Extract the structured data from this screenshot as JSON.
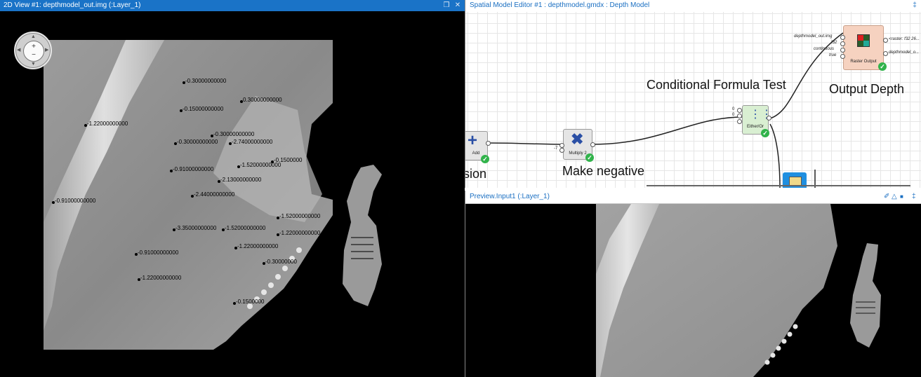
{
  "view2d": {
    "title": "2D View #1: depthmodel_out.img (:Layer_1)",
    "controls": [
      "❒",
      "✕"
    ],
    "nav": {
      "zoom_in": "+",
      "zoom_out": "−"
    },
    "points": [
      {
        "label": "-0.30000000000"
      },
      {
        "label": "0.30000000000"
      },
      {
        "label": "-0.15000000000"
      },
      {
        "label": "-1.22000000000"
      },
      {
        "label": "-0.30000000000"
      },
      {
        "label": "-0.30000000000"
      },
      {
        "label": "-2.74000000000"
      },
      {
        "label": "-0.1500000"
      },
      {
        "label": "-1.52000000000"
      },
      {
        "label": "-0.91000000000"
      },
      {
        "label": "-2.13000000000"
      },
      {
        "label": "-2.44000000000"
      },
      {
        "label": "-0.91000000000"
      },
      {
        "label": "-1.52000000000"
      },
      {
        "label": "-3.35000000000"
      },
      {
        "label": "-1.52000000000"
      },
      {
        "label": "-1.22000000000"
      },
      {
        "label": "-1.22000000000"
      },
      {
        "label": "-0.91000000000"
      },
      {
        "label": "-0.30000000"
      },
      {
        "label": "-1.22000000000"
      },
      {
        "label": "-0.1500000"
      }
    ]
  },
  "editor": {
    "title": "Spatial Model Editor #1 : depthmodel.gmdx : Depth Model",
    "pin": "‡",
    "nodes": {
      "add": {
        "label": "Add"
      },
      "multiply": {
        "label": "Multiply 2",
        "input": "-7"
      },
      "either": {
        "label": "Either/Or",
        "inputs": [
          "0",
          "0"
        ]
      },
      "raster": {
        "label": "Raster Output",
        "inputs": [
          "depthmodel_out.img",
          "f32",
          "continuous",
          "true"
        ],
        "outputs": [
          "<raster: f32 26...",
          "depthmodel_o..."
        ]
      }
    },
    "captions": {
      "conditional": "Conditional Formula Test",
      "output": "Output Depth",
      "negative": "Make negative",
      "expression_tail": "sion"
    }
  },
  "preview": {
    "title": "Preview.Input1 (:Layer_1)",
    "tools": [
      "✐",
      "△",
      "■",
      "‡"
    ]
  },
  "colors": {
    "titlebar_blue": "#1a73c7",
    "link_blue": "#1a6fc2",
    "check_green": "#31b34b",
    "raster_node": "#f6d2c0",
    "either_node": "#d9efd2"
  }
}
